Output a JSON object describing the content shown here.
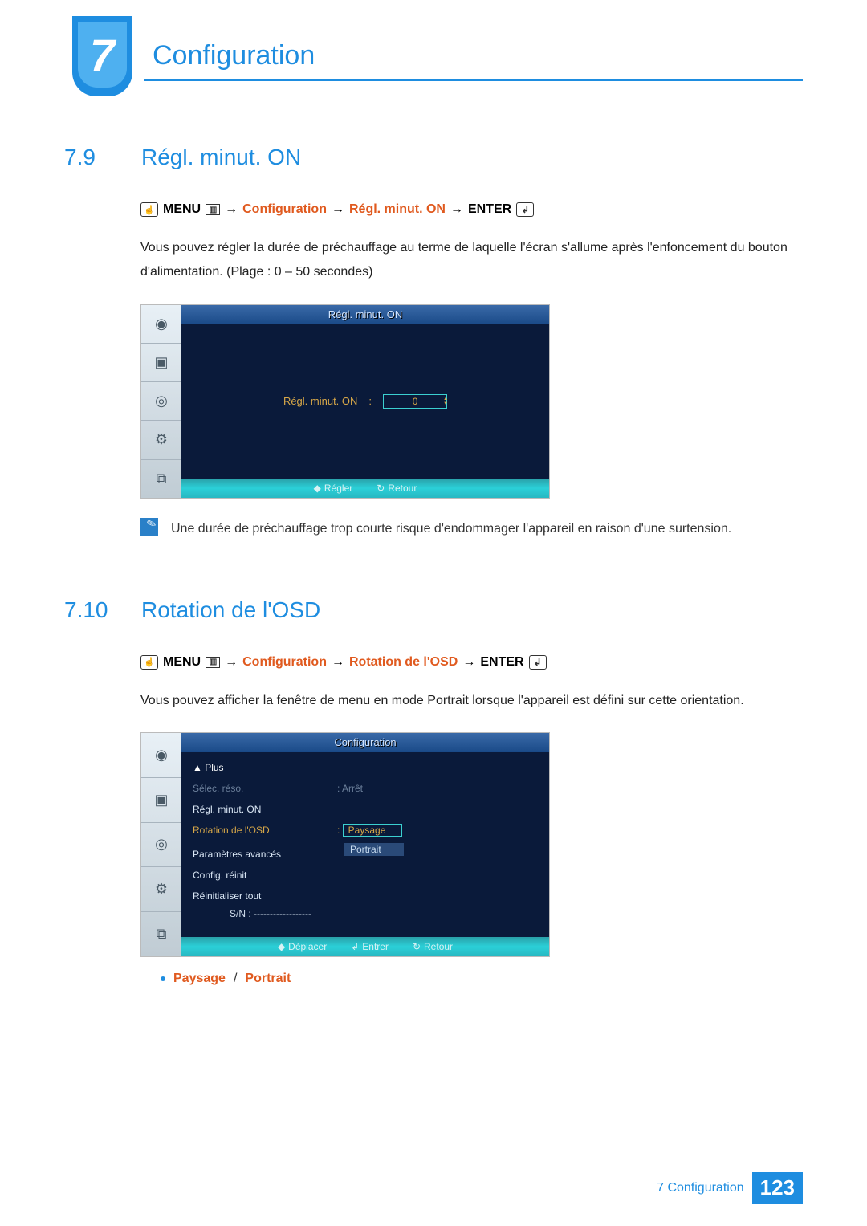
{
  "chapter": {
    "number": "7",
    "title": "Configuration"
  },
  "section1": {
    "num": "7.9",
    "title": "Régl. minut. ON",
    "path": {
      "menu": "MENU",
      "p1": "Configuration",
      "p2": "Régl. minut. ON",
      "enter": "ENTER"
    },
    "body": "Vous pouvez régler la durée de préchauffage au terme de laquelle l'écran s'allume après l'enfoncement du bouton d'alimentation. (Plage : 0 – 50 secondes)",
    "osd": {
      "title": "Régl. minut. ON",
      "label": "Régl. minut. ON",
      "value": "0",
      "foot_adjust": "Régler",
      "foot_return": "Retour"
    },
    "note": "Une durée de préchauffage trop courte risque d'endommager l'appareil en raison d'une surtension."
  },
  "section2": {
    "num": "7.10",
    "title": "Rotation de l'OSD",
    "path": {
      "menu": "MENU",
      "p1": "Configuration",
      "p2": "Rotation de l'OSD",
      "enter": "ENTER"
    },
    "body": "Vous pouvez afficher la fenêtre de menu en mode Portrait lorsque l'appareil est défini sur cette orientation.",
    "osd": {
      "title": "Configuration",
      "plus": "▲ Plus",
      "items": [
        {
          "label": "Sélec. réso.",
          "value": ": Arrêt",
          "dim": true
        },
        {
          "label": "Régl. minut. ON",
          "value": ""
        },
        {
          "label": "Rotation de l'OSD",
          "value_sel": "Paysage",
          "value_alt": "Portrait",
          "hi": true
        },
        {
          "label": "Paramètres avancés",
          "value": ""
        },
        {
          "label": "Config. réinit",
          "value": ""
        },
        {
          "label": "Réinitialiser tout",
          "value": ""
        }
      ],
      "sn": "S/N : ------------------",
      "foot_move": "Déplacer",
      "foot_enter": "Entrer",
      "foot_return": "Retour"
    },
    "options": {
      "a": "Paysage",
      "b": "Portrait"
    }
  },
  "footer": {
    "label": "7 Configuration",
    "page": "123"
  },
  "icons": {
    "hand": "☝",
    "grid": "▥",
    "enter": "↲",
    "updown": "◆",
    "return": "↻"
  }
}
